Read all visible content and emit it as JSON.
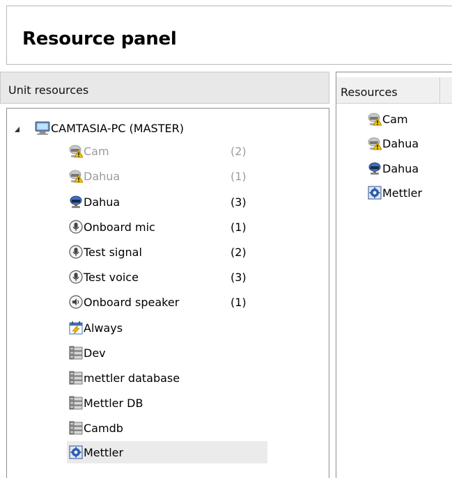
{
  "title": "Resource panel",
  "unit_resources": {
    "header": "Unit resources",
    "root": {
      "label": "CAMTASIA-PC (MASTER)",
      "icon": "computer-icon"
    },
    "items": [
      {
        "label": "Cam",
        "count": "(2)",
        "icon": "camera-warning-icon",
        "dim": true
      },
      {
        "label": "Dahua",
        "count": "(1)",
        "icon": "camera-warning-icon",
        "dim": true
      },
      {
        "label": "Dahua",
        "count": "(3)",
        "icon": "camera-icon",
        "dim": false
      },
      {
        "label": "Onboard mic",
        "count": "(1)",
        "icon": "microphone-icon",
        "dim": false
      },
      {
        "label": "Test signal",
        "count": "(2)",
        "icon": "microphone-icon",
        "dim": false
      },
      {
        "label": "Test voice",
        "count": "(3)",
        "icon": "microphone-icon",
        "dim": false
      },
      {
        "label": "Onboard speaker",
        "count": "(1)",
        "icon": "speaker-icon",
        "dim": false
      },
      {
        "label": "Always",
        "count": "",
        "icon": "schedule-icon",
        "dim": false
      },
      {
        "label": "Dev",
        "count": "",
        "icon": "database-icon",
        "dim": false
      },
      {
        "label": "mettler database",
        "count": "",
        "icon": "database-icon",
        "dim": false
      },
      {
        "label": "Mettler DB",
        "count": "",
        "icon": "database-icon",
        "dim": false
      },
      {
        "label": "Camdb",
        "count": "",
        "icon": "database-icon",
        "dim": false
      },
      {
        "label": "Mettler",
        "count": "",
        "icon": "gear-icon",
        "dim": false,
        "selected": true
      }
    ]
  },
  "resources": {
    "header": "Resources",
    "items": [
      {
        "label": "Cam",
        "icon": "camera-warning-icon"
      },
      {
        "label": "Dahua",
        "icon": "camera-warning-icon"
      },
      {
        "label": "Dahua",
        "icon": "camera-icon"
      },
      {
        "label": "Mettler",
        "icon": "gear-icon"
      }
    ]
  },
  "colors": {
    "dim_text": "#9c9c9c",
    "selection": "#ebebeb",
    "border": "#8e8e8e"
  }
}
